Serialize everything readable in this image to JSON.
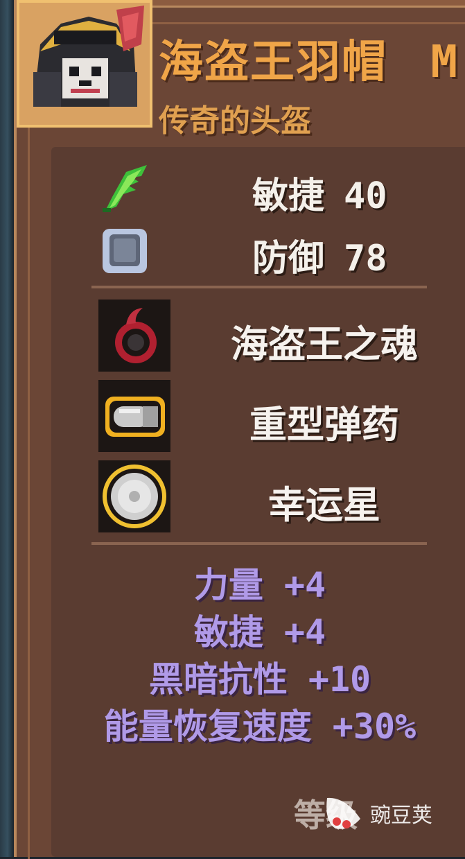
{
  "item": {
    "name": "海盗王羽帽",
    "size_tag": "M",
    "subtitle": "传奇的头盔"
  },
  "stats": [
    {
      "icon": "feather-icon",
      "label": "敏捷",
      "value": "40"
    },
    {
      "icon": "shield-icon",
      "label": "防御",
      "value": "78"
    }
  ],
  "runes": [
    {
      "icon": "pirate-soul-icon",
      "label": "海盗王之魂"
    },
    {
      "icon": "bullet-icon",
      "label": "重型弹药"
    },
    {
      "icon": "lucky-star-icon",
      "label": "幸运星"
    }
  ],
  "bonuses": [
    {
      "label": "力量",
      "value": "+4"
    },
    {
      "label": "敏捷",
      "value": "+4"
    },
    {
      "label": "黑暗抗性",
      "value": "+10"
    },
    {
      "label": "能量恢复速度",
      "value": "+30%"
    }
  ],
  "footer": {
    "level_label": "等级",
    "watermark": "豌豆荚"
  },
  "colors": {
    "panel": "#6b4636",
    "inner_box": "#5a3c31",
    "title": "#f0a548",
    "bonus_text": "#b09ae8"
  }
}
